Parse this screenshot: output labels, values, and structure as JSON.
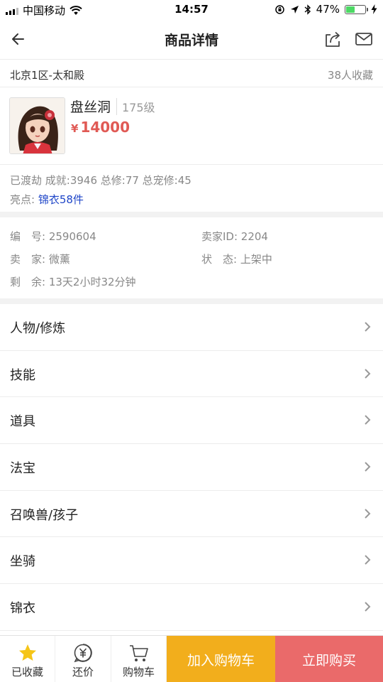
{
  "status_bar": {
    "carrier": "中国移动",
    "time": "14:57",
    "battery_percent": "47%",
    "battery_level": 0.47,
    "icons": [
      "signal-icon",
      "wifi-icon",
      "rotation-lock-icon",
      "location-icon",
      "bluetooth-icon",
      "battery-icon",
      "charging-icon"
    ]
  },
  "nav": {
    "title": "商品详情",
    "icons": [
      "back-arrow-icon",
      "share-icon",
      "mail-icon"
    ]
  },
  "server": {
    "name": "北京1区-太和殿",
    "fav_count": "38人收藏"
  },
  "character": {
    "name": "盘丝洞",
    "level": "175级",
    "price_symbol": "¥",
    "price": "14000"
  },
  "stats": {
    "line": "已渡劫 成就:3946 总修:77 总宠修:45",
    "highlight_label": "亮点:",
    "highlight_value": "锦衣58件"
  },
  "info": {
    "serial": "编　号: 2590604",
    "seller_id": "卖家ID: 2204",
    "seller": "卖　家: 微薰",
    "state": "状　态: 上架中",
    "remaining": "剩　余: 13天2小时32分钟"
  },
  "menu": [
    {
      "label": "人物/修炼"
    },
    {
      "label": "技能"
    },
    {
      "label": "道具"
    },
    {
      "label": "法宝"
    },
    {
      "label": "召唤兽/孩子"
    },
    {
      "label": "坐骑"
    },
    {
      "label": "锦衣"
    }
  ],
  "bottom": {
    "favorited": "已收藏",
    "bargain": "还价",
    "cart": "购物车",
    "add_to_cart": "加入购物车",
    "buy_now": "立即购买"
  },
  "colors": {
    "price": "#e05a55",
    "highlight_link": "#1f46c8",
    "add_to_cart_bg": "#f2ae1c",
    "buy_now_bg": "#ea6a6a",
    "star": "#f5c518",
    "battery_fill": "#4cd964"
  }
}
